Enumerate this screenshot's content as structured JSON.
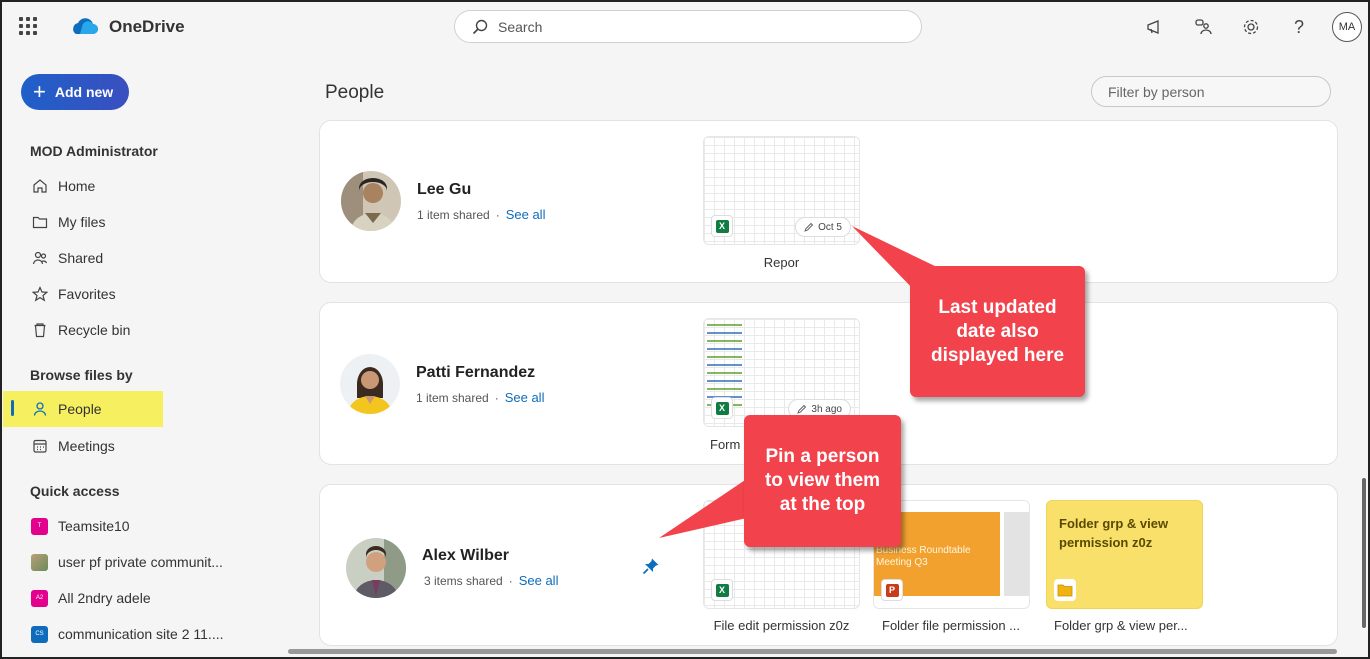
{
  "app": {
    "title": "OneDrive",
    "user_initials": "MA"
  },
  "search": {
    "placeholder": "Search"
  },
  "sidebar": {
    "add_new": "Add new",
    "account": "MOD Administrator",
    "nav": [
      {
        "label": "Home",
        "icon": "home-icon"
      },
      {
        "label": "My files",
        "icon": "folder-icon"
      },
      {
        "label": "Shared",
        "icon": "people-icon"
      },
      {
        "label": "Favorites",
        "icon": "star-icon"
      },
      {
        "label": "Recycle bin",
        "icon": "recycle-bin-icon"
      }
    ],
    "browse_title": "Browse files by",
    "browse": [
      {
        "label": "People",
        "icon": "person-icon",
        "active": true
      },
      {
        "label": "Meetings",
        "icon": "calendar-icon"
      }
    ],
    "quick_title": "Quick access",
    "quick": [
      {
        "label": "Teamsite10",
        "badge": "T",
        "color": "#e3008c"
      },
      {
        "label": "user pf private communit...",
        "badge": "",
        "color": "#8a7a5a"
      },
      {
        "label": "All 2ndry adele",
        "badge": "A2",
        "color": "#e3008c"
      },
      {
        "label": "communication site 2 11....",
        "badge": "CS",
        "color": "#0f6cbd"
      }
    ]
  },
  "main": {
    "title": "People",
    "filter_placeholder": "Filter by person",
    "people": [
      {
        "name": "Lee Gu",
        "items": "1 item shared",
        "see_all": "See all",
        "files": [
          {
            "name": "Repor",
            "date": "Oct 5",
            "type": "excel"
          }
        ]
      },
      {
        "name": "Patti Fernandez",
        "items": "1 item shared",
        "see_all": "See all",
        "files": [
          {
            "name": "Form",
            "date": "3h ago",
            "type": "excel"
          }
        ]
      },
      {
        "name": "Alex Wilber",
        "items": "3 items shared",
        "see_all": "See all",
        "pinned": true,
        "files": [
          {
            "name": "File edit permission z0z",
            "type": "excel"
          },
          {
            "name": "Folder file permission ...",
            "type": "powerpoint",
            "slide_text": "Business Roundtable Meeting Q3"
          },
          {
            "name": "Folder grp & view per...",
            "type": "folder",
            "card_text": "Folder grp & view permission z0z"
          }
        ]
      }
    ]
  },
  "callouts": {
    "date": "Last updated date also displayed here",
    "pin": "Pin a person to view them at the top"
  },
  "colors": {
    "accent": "#0f6cbd",
    "highlight": "#f6f061",
    "callout": "#f2424b"
  }
}
